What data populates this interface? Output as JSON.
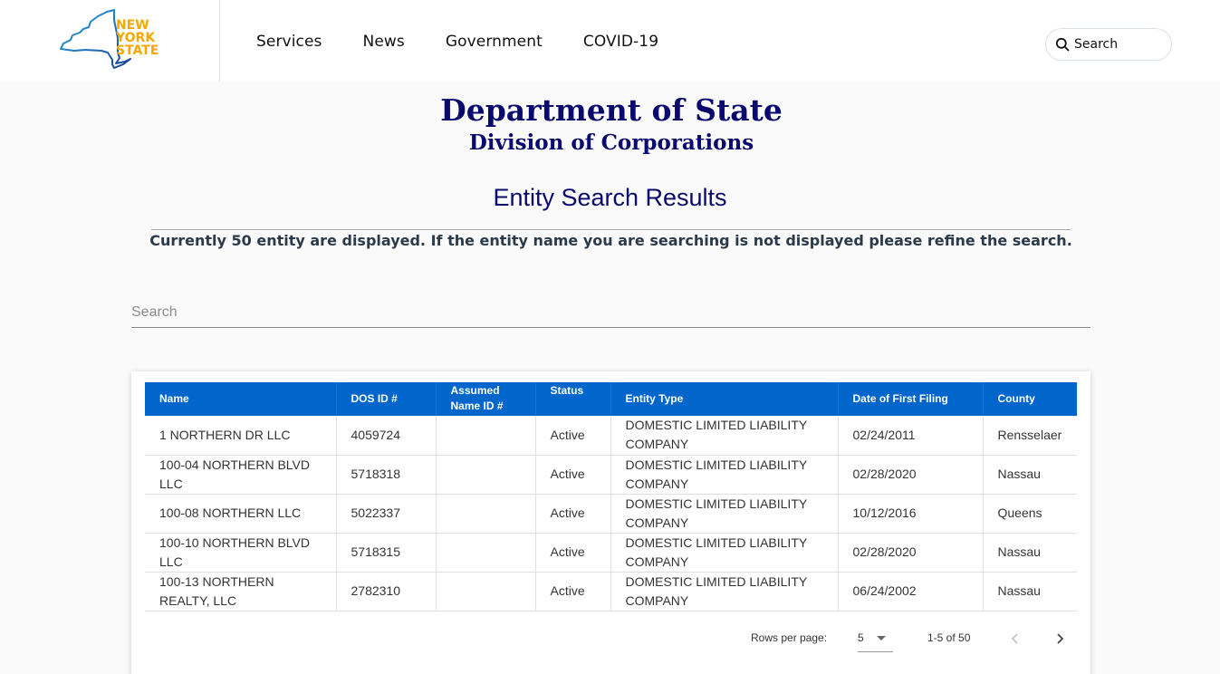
{
  "header": {
    "logo_alt": "New York State",
    "logo_lines": [
      "NEW",
      "YORK",
      "STATE"
    ],
    "nav": [
      {
        "label": "Services"
      },
      {
        "label": "News"
      },
      {
        "label": "Government"
      },
      {
        "label": "COVID-19"
      }
    ],
    "search_button_label": "Search",
    "colors": {
      "logo_text": "#f5a800",
      "logo_outline": "#1a5fb4"
    }
  },
  "page": {
    "department": "Department of State",
    "division": "Division of Corporations",
    "results_title": "Entity Search Results",
    "notice": "Currently 50 entity are displayed. If the entity name you are searching is not displayed please refine the search.",
    "colors": {
      "title": "#0a0a6e",
      "table_header_bg": "#0066cc"
    }
  },
  "search": {
    "placeholder": "Search",
    "value": ""
  },
  "table": {
    "columns": [
      {
        "label": "Name"
      },
      {
        "label": "DOS ID #"
      },
      {
        "label": "Assumed Name ID #"
      },
      {
        "label": "Status"
      },
      {
        "label": "Entity Type"
      },
      {
        "label": "Date of First Filing"
      },
      {
        "label": "County"
      }
    ],
    "rows": [
      {
        "name": "1 NORTHERN DR LLC",
        "dos_id": "4059724",
        "assumed_name_id": "",
        "status": "Active",
        "entity_type": "DOMESTIC LIMITED LIABILITY COMPANY",
        "date_first_filing": "02/24/2011",
        "county": "Rensselaer"
      },
      {
        "name": "100-04 NORTHERN BLVD LLC",
        "dos_id": "5718318",
        "assumed_name_id": "",
        "status": "Active",
        "entity_type": "DOMESTIC LIMITED LIABILITY COMPANY",
        "date_first_filing": "02/28/2020",
        "county": "Nassau"
      },
      {
        "name": "100-08 NORTHERN LLC",
        "dos_id": "5022337",
        "assumed_name_id": "",
        "status": "Active",
        "entity_type": "DOMESTIC LIMITED LIABILITY COMPANY",
        "date_first_filing": "10/12/2016",
        "county": "Queens"
      },
      {
        "name": "100-10 NORTHERN BLVD LLC",
        "dos_id": "5718315",
        "assumed_name_id": "",
        "status": "Active",
        "entity_type": "DOMESTIC LIMITED LIABILITY COMPANY",
        "date_first_filing": "02/28/2020",
        "county": "Nassau"
      },
      {
        "name": "100-13 NORTHERN REALTY, LLC",
        "dos_id": "2782310",
        "assumed_name_id": "",
        "status": "Active",
        "entity_type": "DOMESTIC LIMITED LIABILITY COMPANY",
        "date_first_filing": "06/24/2002",
        "county": "Nassau"
      }
    ]
  },
  "pagination": {
    "rows_per_page_label": "Rows per page:",
    "rows_per_page_value": "5",
    "range_label": "1-5 of 50",
    "prev_icon": "chevron-left-icon",
    "next_icon": "chevron-right-icon"
  }
}
